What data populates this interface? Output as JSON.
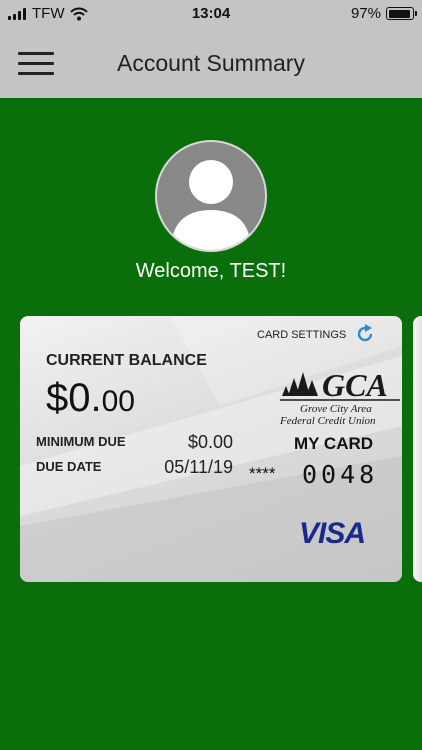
{
  "status_bar": {
    "carrier": "TFW",
    "time": "13:04",
    "battery_percent": "97%",
    "battery_level": 0.97,
    "icons": [
      "signal-icon",
      "wifi-icon",
      "battery-icon"
    ]
  },
  "nav": {
    "title": "Account Summary",
    "menu_icon": "hamburger-menu-icon"
  },
  "profile": {
    "avatar_icon": "user-silhouette-icon",
    "welcome": "Welcome, TEST!"
  },
  "card": {
    "settings_label": "CARD SETTINGS",
    "settings_icon": "refresh-icon",
    "current_balance_label": "CURRENT BALANCE",
    "balance_dollars": "$0.",
    "balance_cents": "00",
    "minimum_due_label": "MINIMUM DUE",
    "minimum_due_value": "$0.00",
    "due_date_label": "DUE DATE",
    "due_date_value": "05/11/19",
    "logo_text": "GCA",
    "logo_line1": "Grove City Area",
    "logo_line2": "Federal Credit Union",
    "card_name": "MY CARD",
    "mask": "****",
    "last_four": "0048",
    "network": "VISA"
  },
  "colors": {
    "background": "#0a6f0a",
    "nav": "#c4c4c4",
    "visa_blue": "#1a2a8c",
    "refresh_blue": "#2a8ad8"
  }
}
